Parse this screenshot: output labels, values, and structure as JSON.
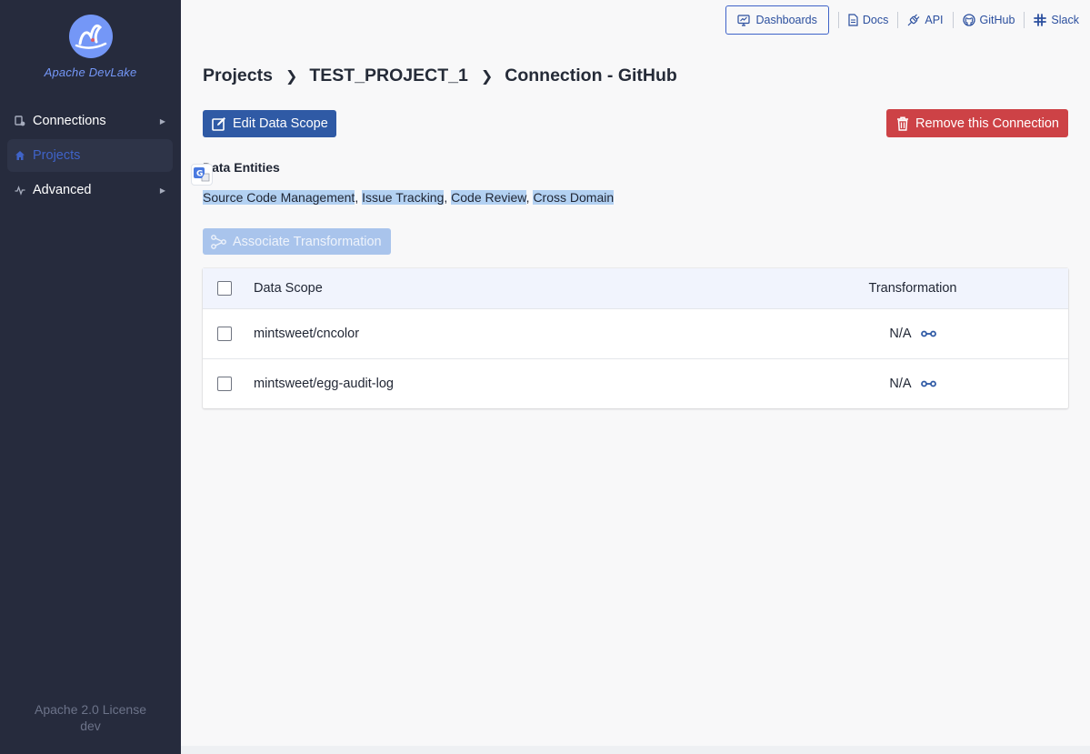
{
  "sidebar": {
    "brand": "Apache DevLake",
    "items": [
      {
        "label": "Connections",
        "icon": "connections-icon",
        "active": false
      },
      {
        "label": "Projects",
        "icon": "home-icon",
        "active": true
      },
      {
        "label": "Advanced",
        "icon": "pulse-icon",
        "active": false
      }
    ],
    "footer_license": "Apache 2.0 License",
    "footer_version": "dev"
  },
  "topbar": {
    "dashboards": "Dashboards",
    "docs": "Docs",
    "api": "API",
    "github": "GitHub",
    "slack": "Slack"
  },
  "breadcrumb": {
    "root": "Projects",
    "project": "TEST_PROJECT_1",
    "current": "Connection - GitHub"
  },
  "actions": {
    "edit_scope": "Edit Data Scope",
    "remove_connection": "Remove this Connection",
    "associate_transformation": "Associate Transformation"
  },
  "entities": {
    "title": "Data Entities",
    "items": [
      "Source Code Management",
      "Issue Tracking",
      "Code Review",
      "Cross Domain"
    ],
    "separator": ", "
  },
  "table": {
    "headers": {
      "scope": "Data Scope",
      "transformation": "Transformation"
    },
    "rows": [
      {
        "scope": "mintsweet/cncolor",
        "transformation": "N/A"
      },
      {
        "scope": "mintsweet/egg-audit-log",
        "transformation": "N/A"
      }
    ]
  },
  "colors": {
    "sidebar_bg": "#262b3d",
    "brand": "#7497f7",
    "primary": "#2f5aa5",
    "danger": "#cd4246",
    "link": "#2b4f9e"
  }
}
